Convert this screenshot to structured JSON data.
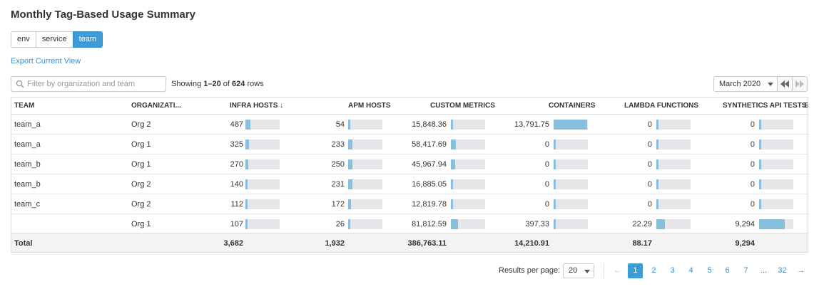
{
  "title": "Monthly Tag-Based Usage Summary",
  "tag_buttons": [
    "env",
    "service",
    "team"
  ],
  "active_tag": "team",
  "export_label": "Export Current View",
  "filter": {
    "placeholder": "Filter by organization and team",
    "value": ""
  },
  "showing": {
    "prefix": "Showing ",
    "range": "1–20",
    "of": " of ",
    "total": "624",
    "suffix": " rows"
  },
  "month": "March 2020",
  "columns": [
    "TEAM",
    "ORGANIZATI...",
    "INFRA HOSTS ↓",
    "APM HOSTS",
    "CUSTOM METRICS",
    "CONTAINERS",
    "LAMBDA FUNCTIONS",
    "SYNTHETICS API TESTS",
    "S"
  ],
  "rows": [
    {
      "team": "team_a",
      "org": "Org 2",
      "infra": "487",
      "infra_f": 0.15,
      "apm": "54",
      "apm_f": 0.0,
      "custom": "15,848.36",
      "custom_f": 0.04,
      "containers": "13,791.75",
      "containers_f": 0.97,
      "lambda": "0",
      "lambda_f": 0,
      "synth": "0",
      "synth_f": 0
    },
    {
      "team": "team_a",
      "org": "Org 1",
      "infra": "325",
      "infra_f": 0.1,
      "apm": "233",
      "apm_f": 0.13,
      "custom": "58,417.69",
      "custom_f": 0.15,
      "containers": "0",
      "containers_f": 0,
      "lambda": "0",
      "lambda_f": 0,
      "synth": "0",
      "synth_f": 0
    },
    {
      "team": "team_b",
      "org": "Org 1",
      "infra": "270",
      "infra_f": 0.08,
      "apm": "250",
      "apm_f": 0.13,
      "custom": "45,967.94",
      "custom_f": 0.12,
      "containers": "0",
      "containers_f": 0,
      "lambda": "0",
      "lambda_f": 0,
      "synth": "0",
      "synth_f": 0
    },
    {
      "team": "team_b",
      "org": "Org 2",
      "infra": "140",
      "infra_f": 0.04,
      "apm": "231",
      "apm_f": 0.12,
      "custom": "16,885.05",
      "custom_f": 0.04,
      "containers": "0",
      "containers_f": 0,
      "lambda": "0",
      "lambda_f": 0,
      "synth": "0",
      "synth_f": 0
    },
    {
      "team": "team_c",
      "org": "Org 2",
      "infra": "112",
      "infra_f": 0.03,
      "apm": "172",
      "apm_f": 0.09,
      "custom": "12,819.78",
      "custom_f": 0.03,
      "containers": "0",
      "containers_f": 0,
      "lambda": "0",
      "lambda_f": 0,
      "synth": "0",
      "synth_f": 0
    },
    {
      "team": "",
      "org": "Org 1",
      "infra": "107",
      "infra_f": 0.03,
      "apm": "26",
      "apm_f": 0.0,
      "custom": "81,812.59",
      "custom_f": 0.21,
      "containers": "397.33",
      "containers_f": 0.03,
      "lambda": "22.29",
      "lambda_f": 0.25,
      "synth": "9,294",
      "synth_f": 0.75
    }
  ],
  "totals": {
    "label": "Total",
    "infra": "3,682",
    "apm": "1,932",
    "custom": "386,763.11",
    "containers": "14,210.91",
    "lambda": "88.17",
    "synth": "9,294"
  },
  "pagination": {
    "rpp_label": "Results per page:",
    "rpp_value": "20",
    "pages": [
      "1",
      "2",
      "3",
      "4",
      "5",
      "6",
      "7",
      "...",
      "32"
    ],
    "active_page": "1",
    "prev": "←",
    "next": "→"
  },
  "colors": {
    "accent": "#3d9cd6",
    "bar_fill": "#87bfdc",
    "bar_track": "#e5e6ea"
  },
  "icons": {
    "filter": "search-icon",
    "rewind": "rewind-icon",
    "forward": "forward-icon"
  }
}
